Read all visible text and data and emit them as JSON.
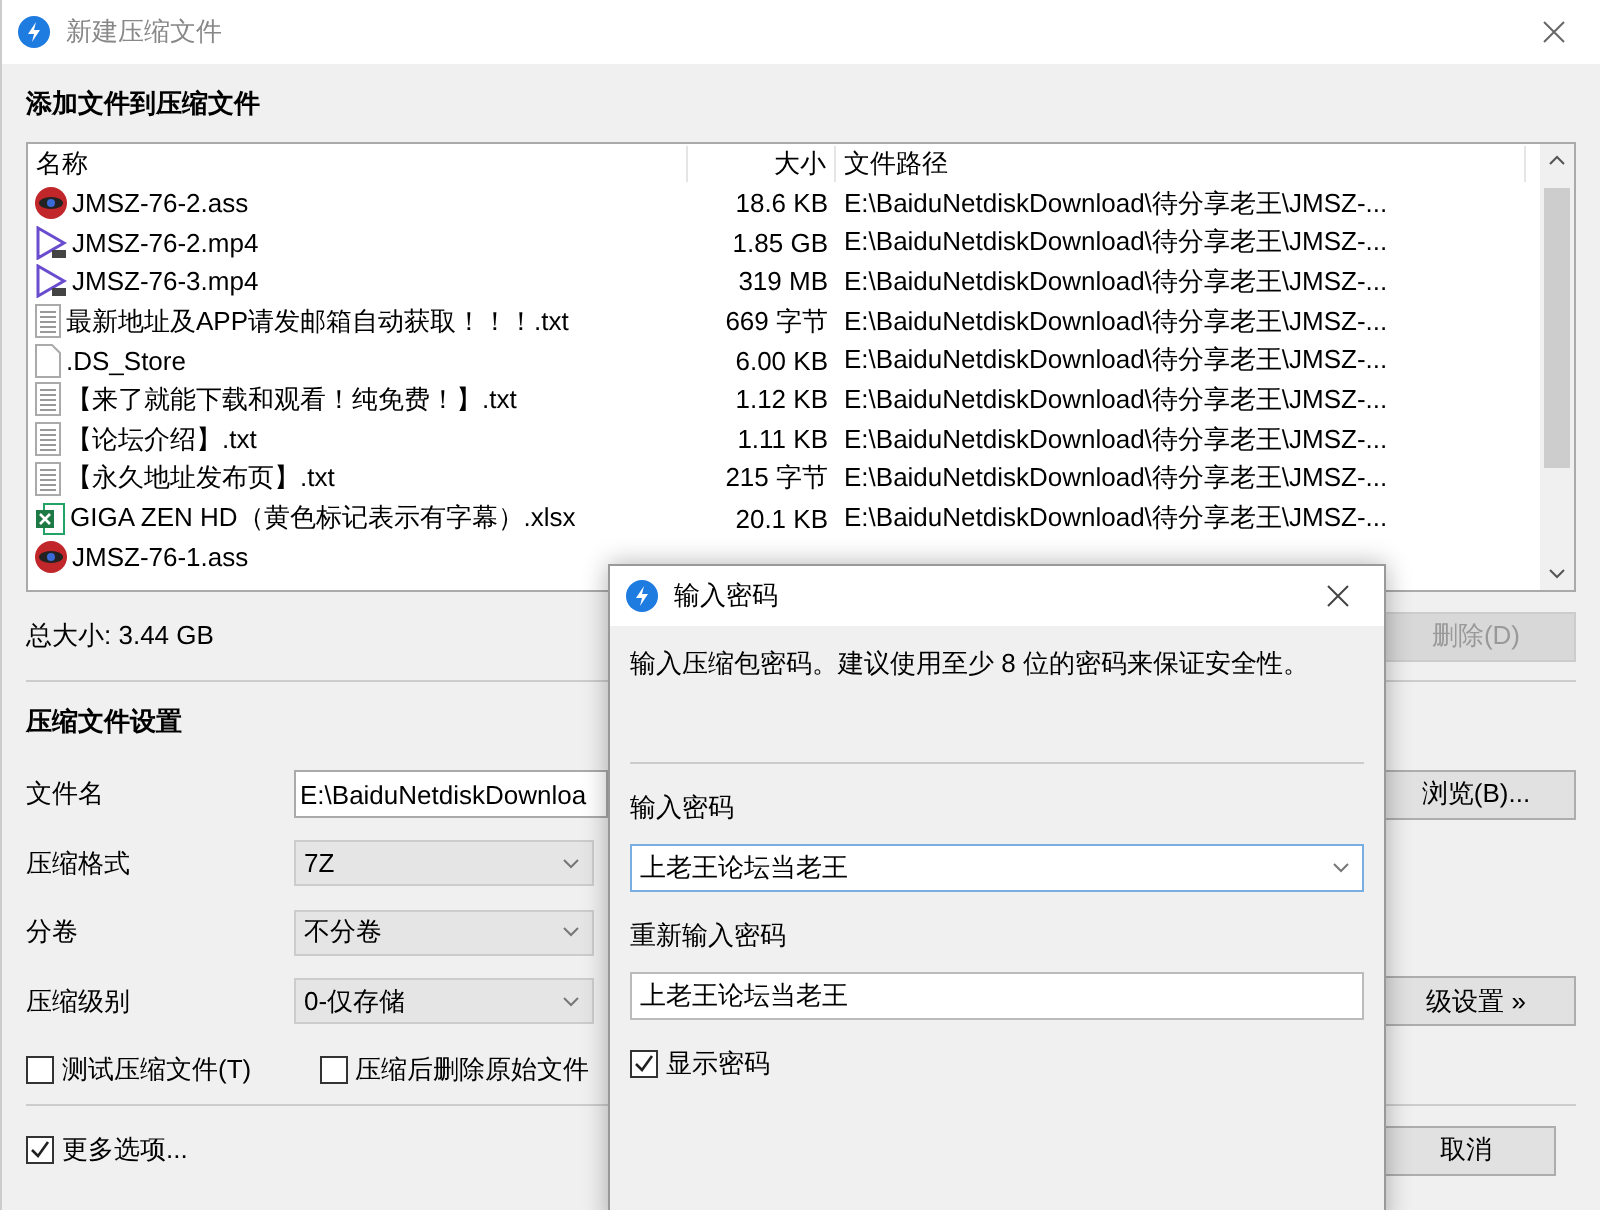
{
  "window": {
    "title": "新建压缩文件"
  },
  "files_section": {
    "title": "添加文件到压缩文件",
    "columns": [
      "名称",
      "大小",
      "文件路径"
    ],
    "rows": [
      {
        "kind": "subtitle",
        "name": "JMSZ-76-2.ass",
        "size": "18.6 KB",
        "path": "E:\\BaiduNetdiskDownload\\待分享老王\\JMSZ-..."
      },
      {
        "kind": "video",
        "name": "JMSZ-76-2.mp4",
        "size": "1.85 GB",
        "path": "E:\\BaiduNetdiskDownload\\待分享老王\\JMSZ-..."
      },
      {
        "kind": "video",
        "name": "JMSZ-76-3.mp4",
        "size": "319 MB",
        "path": "E:\\BaiduNetdiskDownload\\待分享老王\\JMSZ-..."
      },
      {
        "kind": "text",
        "name": "最新地址及APP请发邮箱自动获取！！！.txt",
        "size": "669 字节",
        "path": "E:\\BaiduNetdiskDownload\\待分享老王\\JMSZ-..."
      },
      {
        "kind": "blank",
        "name": ".DS_Store",
        "size": "6.00 KB",
        "path": "E:\\BaiduNetdiskDownload\\待分享老王\\JMSZ-..."
      },
      {
        "kind": "text",
        "name": "【来了就能下载和观看！纯免费！】.txt",
        "size": "1.12 KB",
        "path": "E:\\BaiduNetdiskDownload\\待分享老王\\JMSZ-..."
      },
      {
        "kind": "text",
        "name": "【论坛介绍】.txt",
        "size": "1.11 KB",
        "path": "E:\\BaiduNetdiskDownload\\待分享老王\\JMSZ-..."
      },
      {
        "kind": "text",
        "name": "【永久地址发布页】.txt",
        "size": "215 字节",
        "path": "E:\\BaiduNetdiskDownload\\待分享老王\\JMSZ-..."
      },
      {
        "kind": "excel",
        "name": "GIGA ZEN HD（黄色标记表示有字幕）.xlsx",
        "size": "20.1 KB",
        "path": "E:\\BaiduNetdiskDownload\\待分享老王\\JMSZ-..."
      },
      {
        "kind": "subtitle",
        "name": "JMSZ-76-1.ass"
      }
    ],
    "total": "总大小: 3.44 GB",
    "delete_button": {
      "label": "删除(D)",
      "disabled": true
    }
  },
  "settings": {
    "title": "压缩文件设置",
    "filename": {
      "label": "文件名",
      "value": "E:\\BaiduNetdiskDownloa",
      "browse": "浏览(B)..."
    },
    "selects": [
      {
        "label": "压缩格式",
        "value": "7Z"
      },
      {
        "label": "分卷",
        "value": "不分卷"
      },
      {
        "label": "压缩级别",
        "value": "0-仅存储"
      }
    ],
    "advanced": "级设置 »",
    "checkboxes": [
      {
        "label": "测试压缩文件(T)",
        "checked": false
      },
      {
        "label": "压缩后删除原始文件",
        "checked": false
      }
    ]
  },
  "more_options": {
    "label": "更多选项...",
    "checked": true
  },
  "cancel": "取消",
  "dialog": {
    "title": "输入密码",
    "hint": "输入压缩包密码。建议使用至少 8 位的密码来保证安全性。",
    "password_label": "输入密码",
    "password": "上老王论坛当老王",
    "confirm_label": "重新输入密码",
    "confirm": "上老王论坛当老王",
    "show_password": {
      "label": "显示密码",
      "checked": true
    }
  }
}
